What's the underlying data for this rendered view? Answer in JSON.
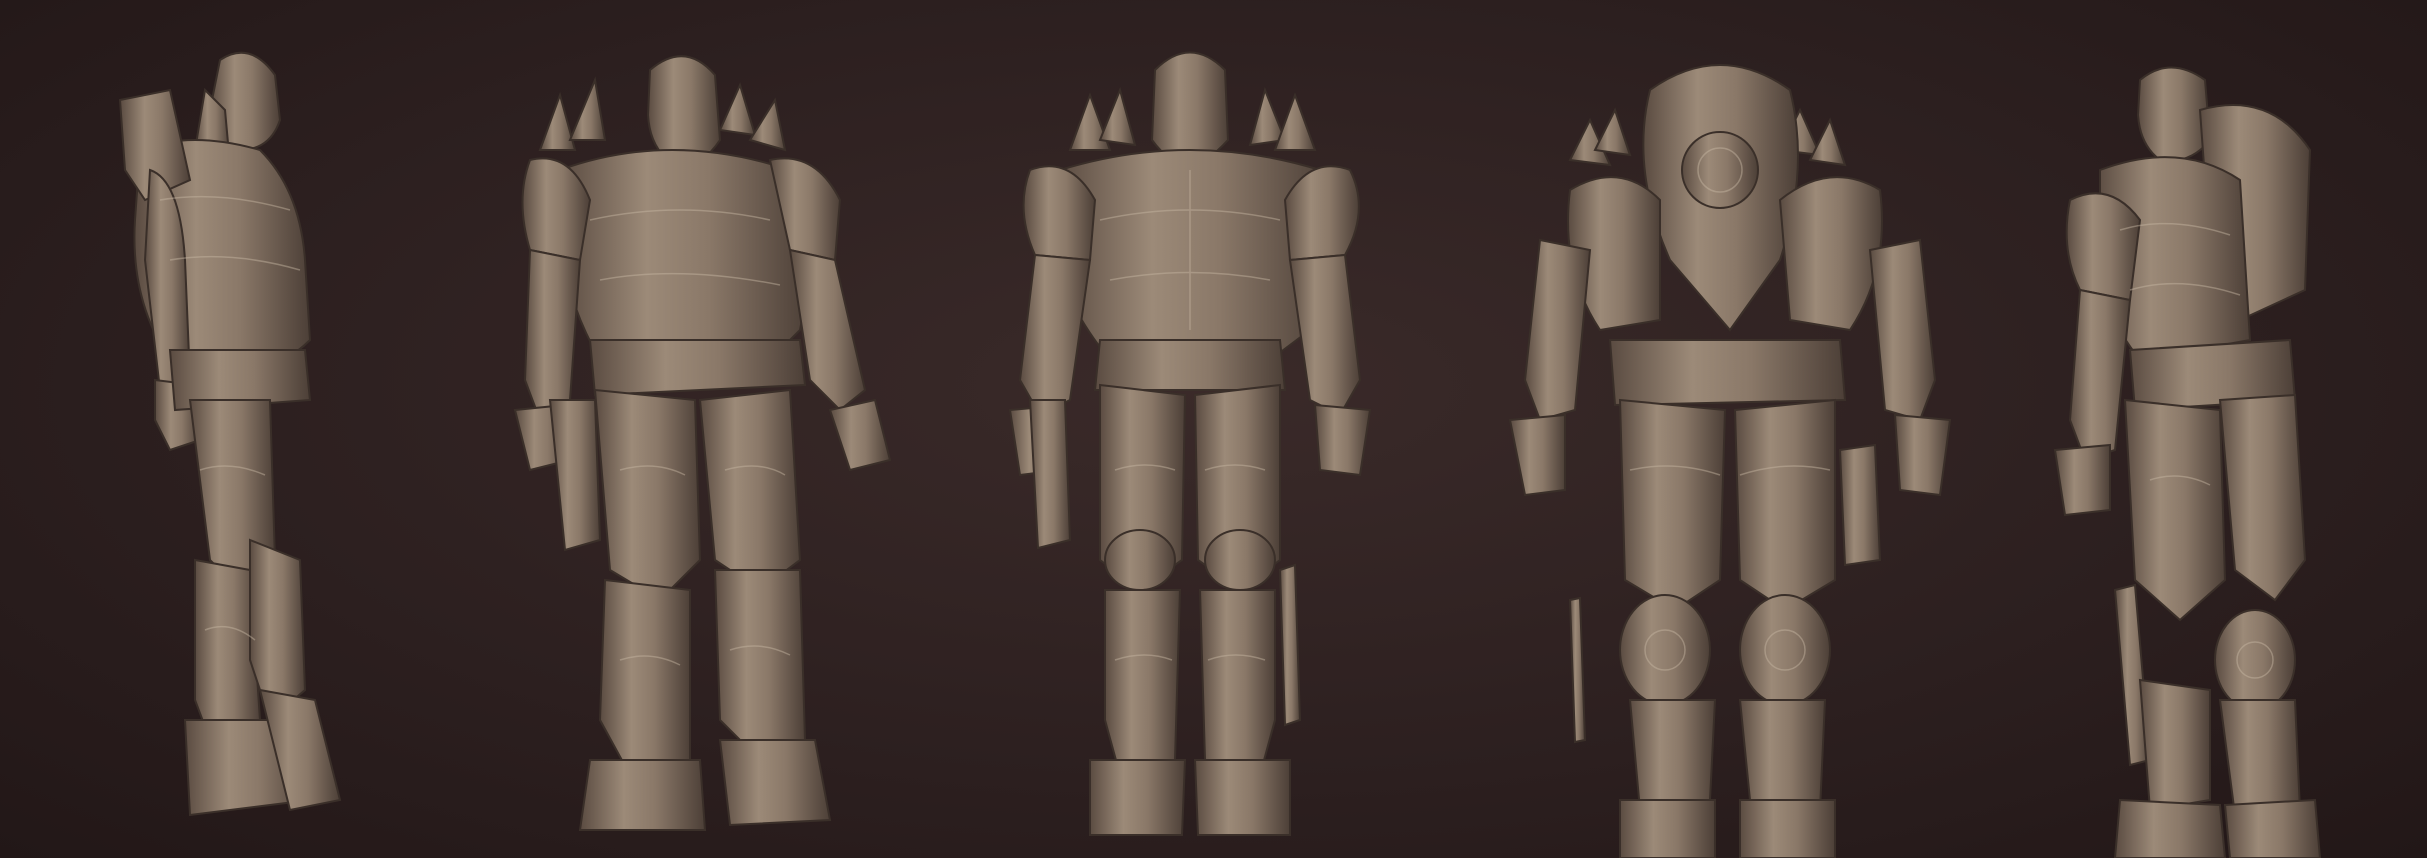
{
  "scene": {
    "background_color": "#2a1d1d",
    "material_color": "#8a7868",
    "material_shadow": "#4f4239",
    "material_highlight": "#b5a592"
  },
  "views": [
    {
      "name": "side-left"
    },
    {
      "name": "three-quarter-front"
    },
    {
      "name": "front"
    },
    {
      "name": "back"
    },
    {
      "name": "three-quarter-back"
    }
  ]
}
